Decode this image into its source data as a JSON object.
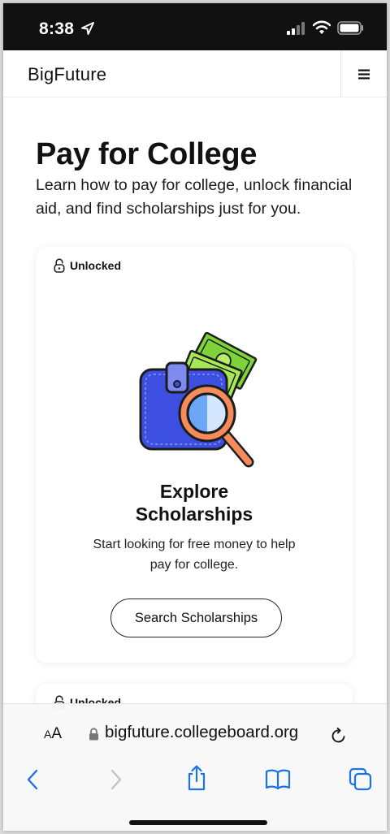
{
  "status_bar": {
    "time": "8:38",
    "icons": [
      "location-arrow-icon",
      "cellular-signal-icon",
      "wifi-icon",
      "battery-icon"
    ]
  },
  "header": {
    "brand": "BigFuture",
    "menu_icon": "hamburger-menu-icon"
  },
  "hero": {
    "title": "Pay for College",
    "subtitle": "Learn how to pay for college, unlock financial aid, and find scholarships just for you."
  },
  "card": {
    "badge_label": "Unlocked",
    "badge_icon": "unlocked-padlock-icon",
    "illustration": "wallet-magnifying-glass-illustration",
    "title": "Explore Scholarships",
    "description": "Start looking for free money to help pay for college.",
    "button_label": "Search Scholarships"
  },
  "next_card": {
    "badge_label": "Unlocked"
  },
  "browser": {
    "text_size_small": "A",
    "text_size_large": "A",
    "url": "bigfuture.collegeboard.org",
    "toolbar": [
      "back-icon",
      "forward-icon",
      "share-icon",
      "bookmarks-icon",
      "tabs-icon"
    ],
    "accent_color": "#1a73e8"
  },
  "colors": {
    "wallet_blue": "#3d4fe0",
    "money_green": "#8fdc3a",
    "magnifier_orange": "#f58a5a"
  }
}
